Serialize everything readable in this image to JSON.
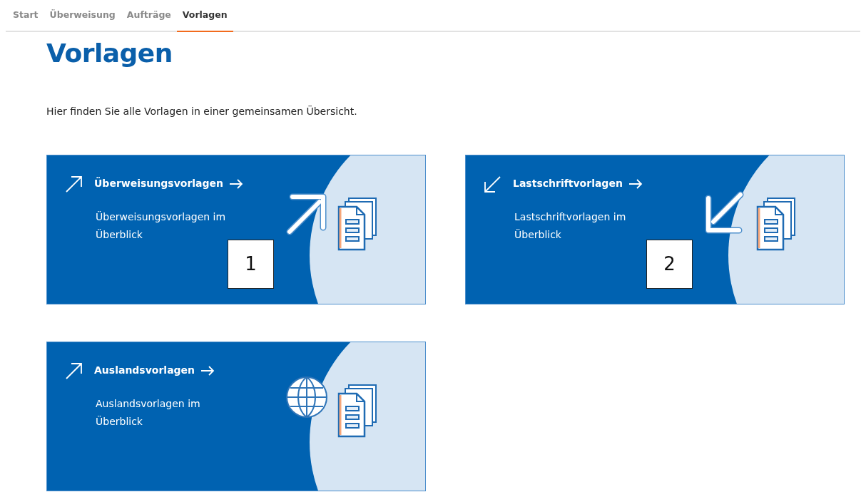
{
  "tabs": [
    {
      "label": "Start",
      "selected": false
    },
    {
      "label": "Überweisung",
      "selected": false
    },
    {
      "label": "Aufträge",
      "selected": false
    },
    {
      "label": "Vorlagen",
      "selected": true
    }
  ],
  "heading": "Vorlagen",
  "intro": "Hier finden Sie alle Vorlagen in einer gemeinsamen Übersicht.",
  "cards": [
    {
      "kind": "outgoing",
      "title": "Überweisungsvorlagen",
      "description": "Überweisungsvorlagen im Überblick",
      "marker": "1"
    },
    {
      "kind": "incoming",
      "title": "Lastschriftvorlagen",
      "description": "Lastschriftvorlagen im Überblick",
      "marker": "2"
    },
    {
      "kind": "foreign",
      "title": "Auslandsvorlagen",
      "description": "Auslandsvorlagen im Überblick"
    }
  ]
}
